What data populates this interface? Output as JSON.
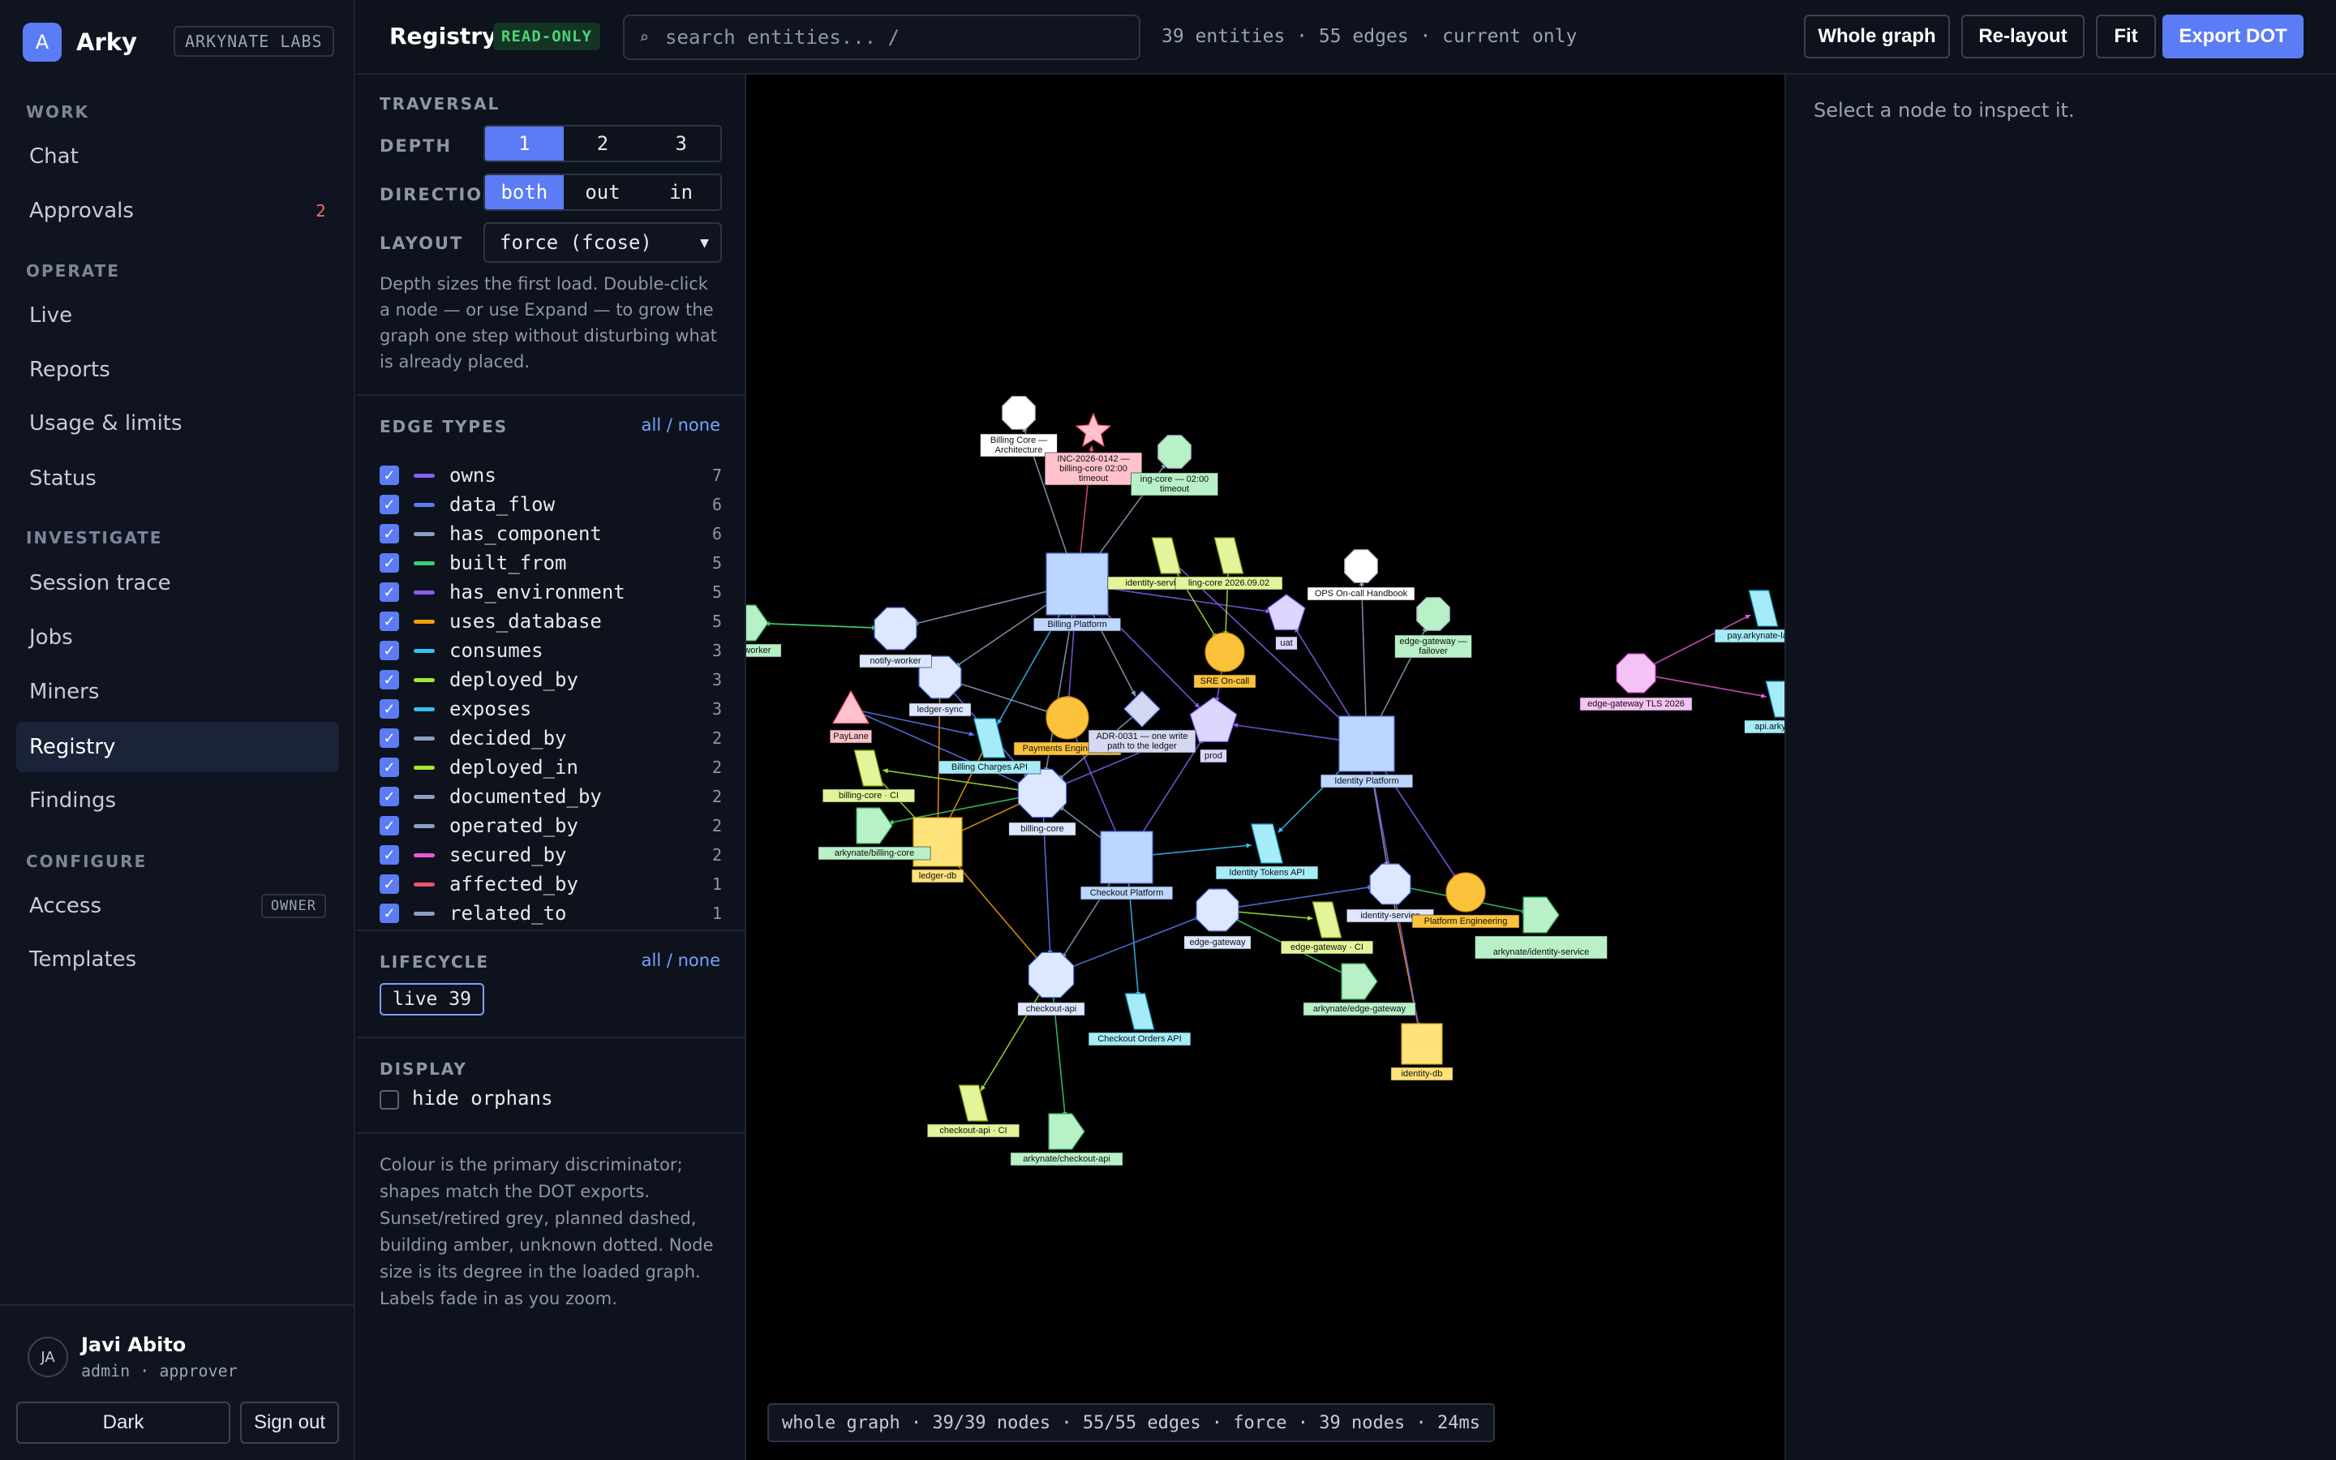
{
  "brand": {
    "logo_letter": "A",
    "name": "Arky",
    "org": "ARKYNATE LABS"
  },
  "nav": {
    "sections": [
      {
        "title": "WORK",
        "items": [
          {
            "label": "Chat"
          },
          {
            "label": "Approvals",
            "count": "2"
          }
        ]
      },
      {
        "title": "OPERATE",
        "items": [
          {
            "label": "Live"
          },
          {
            "label": "Reports"
          },
          {
            "label": "Usage & limits"
          },
          {
            "label": "Status"
          }
        ]
      },
      {
        "title": "INVESTIGATE",
        "items": [
          {
            "label": "Session trace"
          },
          {
            "label": "Jobs"
          },
          {
            "label": "Miners"
          },
          {
            "label": "Registry",
            "active": true
          },
          {
            "label": "Findings"
          }
        ]
      },
      {
        "title": "CONFIGURE",
        "items": [
          {
            "label": "Access",
            "tag": "OWNER"
          },
          {
            "label": "Templates"
          }
        ]
      }
    ]
  },
  "user": {
    "initials": "JA",
    "name": "Javi Abito",
    "role": "admin · approver",
    "theme_button": "Dark",
    "signout_button": "Sign out"
  },
  "header": {
    "title": "Registry",
    "badge": "READ-ONLY",
    "search_placeholder": "search entities...  /",
    "stats": "39 entities · 55 edges · current only",
    "buttons": {
      "whole_graph": "Whole graph",
      "relayout": "Re-layout",
      "fit": "Fit",
      "export": "Export DOT"
    }
  },
  "traversal": {
    "title": "TRAVERSAL",
    "depth_label": "DEPTH",
    "depth_options": [
      "1",
      "2",
      "3"
    ],
    "depth_selected": "1",
    "direction_label": "DIRECTION",
    "direction_options": [
      "both",
      "out",
      "in"
    ],
    "direction_selected": "both",
    "layout_label": "LAYOUT",
    "layout_value": "force (fcose)",
    "help": "Depth sizes the first load. Double-click a node — or use Expand — to grow the graph one step without disturbing what is already placed."
  },
  "edge_types": {
    "title": "EDGE TYPES",
    "toggle": "all / none",
    "items": [
      {
        "name": "owns",
        "count": "7",
        "color": "#8b5cf6"
      },
      {
        "name": "data_flow",
        "count": "6",
        "color": "#5b7cf5"
      },
      {
        "name": "has_component",
        "count": "6",
        "color": "#8aa0c0"
      },
      {
        "name": "built_from",
        "count": "5",
        "color": "#3fcf6e"
      },
      {
        "name": "has_environment",
        "count": "5",
        "color": "#8b5cf6"
      },
      {
        "name": "uses_database",
        "count": "5",
        "color": "#f59e0b"
      },
      {
        "name": "consumes",
        "count": "3",
        "color": "#38bdf8"
      },
      {
        "name": "deployed_by",
        "count": "3",
        "color": "#a3e635"
      },
      {
        "name": "exposes",
        "count": "3",
        "color": "#38bdf8"
      },
      {
        "name": "decided_by",
        "count": "2",
        "color": "#8aa0c0"
      },
      {
        "name": "deployed_in",
        "count": "2",
        "color": "#a3e635"
      },
      {
        "name": "documented_by",
        "count": "2",
        "color": "#8aa0c0"
      },
      {
        "name": "operated_by",
        "count": "2",
        "color": "#8aa0c0"
      },
      {
        "name": "secured_by",
        "count": "2",
        "color": "#e85ad8"
      },
      {
        "name": "affected_by",
        "count": "1",
        "color": "#f0506e"
      },
      {
        "name": "related_to",
        "count": "1",
        "color": "#8aa0c0"
      }
    ]
  },
  "lifecycle": {
    "title": "LIFECYCLE",
    "toggle": "all / none",
    "chip": "live 39"
  },
  "display": {
    "title": "DISPLAY",
    "hide_orphans": "hide orphans"
  },
  "legend_note": "Colour is the primary discriminator; shapes match the DOT exports. Sunset/retired grey, planned dashed, building amber, unknown dotted. Node size is its degree in the loaded graph. Labels fade in as you zoom.",
  "status_bar": "whole graph · 39/39 nodes · 55/55 edges · force · 39 nodes · 24ms",
  "inspector": {
    "hint": "Select a node to inspect it."
  },
  "graph": {
    "nodes": [
      {
        "id": "billing-platform",
        "label": "Billing Platform",
        "kind": "system",
        "color": "#bcd6ff"
      },
      {
        "id": "identity-platform",
        "label": "Identity Platform",
        "kind": "system",
        "color": "#bcd6ff"
      },
      {
        "id": "checkout-platform",
        "label": "Checkout Platform",
        "kind": "system",
        "color": "#bcd6ff"
      },
      {
        "id": "billing-core",
        "label": "billing-core",
        "kind": "service",
        "color": "#dde7ff"
      },
      {
        "id": "ledger-sync",
        "label": "ledger-sync",
        "kind": "service",
        "color": "#dde7ff"
      },
      {
        "id": "notify-worker",
        "label": "notify-worker",
        "kind": "service",
        "color": "#dde7ff"
      },
      {
        "id": "checkout-api",
        "label": "checkout-api",
        "kind": "service",
        "color": "#dde7ff"
      },
      {
        "id": "edge-gateway",
        "label": "edge-gateway",
        "kind": "service",
        "color": "#dde7ff"
      },
      {
        "id": "identity-service",
        "label": "identity-service",
        "kind": "service",
        "color": "#dde7ff"
      },
      {
        "id": "ledger-db",
        "label": "ledger-db",
        "kind": "database",
        "color": "#ffe27a"
      },
      {
        "id": "identity-db",
        "label": "identity-db",
        "kind": "database",
        "color": "#ffe27a"
      },
      {
        "id": "payments-eng",
        "label": "Payments Engineering",
        "kind": "team",
        "color": "#fcc23b"
      },
      {
        "id": "sre-oncall",
        "label": "SRE On-call",
        "kind": "team",
        "color": "#fcc23b"
      },
      {
        "id": "platform-eng",
        "label": "Platform Engineering",
        "kind": "team",
        "color": "#fcc23b"
      },
      {
        "id": "billing-charges-api",
        "label": "Billing Charges API",
        "kind": "api",
        "color": "#a6ecf8"
      },
      {
        "id": "identity-tokens-api",
        "label": "Identity Tokens API",
        "kind": "api",
        "color": "#a6ecf8"
      },
      {
        "id": "checkout-orders-api",
        "label": "Checkout Orders API",
        "kind": "api",
        "color": "#a6ecf8"
      },
      {
        "id": "pay-host",
        "label": "pay.arkynate-labs.",
        "kind": "api",
        "color": "#a6ecf8"
      },
      {
        "id": "api-host",
        "label": "api.arkynate-",
        "kind": "api",
        "color": "#a6ecf8"
      },
      {
        "id": "billing-core-ci",
        "label": "billing-core · CI",
        "kind": "pipeline",
        "color": "#e2f59a"
      },
      {
        "id": "edge-gateway-ci",
        "label": "edge-gateway · CI",
        "kind": "pipeline",
        "color": "#e2f59a"
      },
      {
        "id": "checkout-api-ci",
        "label": "checkout-api · CI",
        "kind": "pipeline",
        "color": "#e2f59a"
      },
      {
        "id": "repo-billing-core",
        "label": "arkynate/billing-core",
        "kind": "repo",
        "color": "#b8f0c8"
      },
      {
        "id": "repo-identity-service",
        "label": "arkynate/identity-service",
        "kind": "repo",
        "color": "#b8f0c8"
      },
      {
        "id": "repo-edge-gateway",
        "label": "arkynate/edge-gateway",
        "kind": "repo",
        "color": "#b8f0c8"
      },
      {
        "id": "repo-checkout-api",
        "label": "arkynate/checkout-api",
        "kind": "repo",
        "color": "#b8f0c8"
      },
      {
        "id": "repo-notify-worker",
        "label": "tify-worker",
        "kind": "repo",
        "color": "#b8f0c8"
      },
      {
        "id": "release-identity",
        "label": "identity-service 3.4.0",
        "kind": "release",
        "color": "#e2f59a"
      },
      {
        "id": "release-billing",
        "label": "ling-core 2026.09.02",
        "kind": "release",
        "color": "#e2f59a"
      },
      {
        "id": "env-uat",
        "label": "uat",
        "kind": "environment",
        "color": "#ddd6fe"
      },
      {
        "id": "env-prod",
        "label": "prod",
        "kind": "environment",
        "color": "#ddd6fe"
      },
      {
        "id": "adr-0031",
        "label": "ADR-0031 — one write path to the ledger",
        "kind": "decision",
        "color": "#d4d8f0"
      },
      {
        "id": "doc-billing-arch",
        "label": "Billing Core — Architecture",
        "kind": "document",
        "color": "#ffffff"
      },
      {
        "id": "doc-ops-oncall",
        "label": "OPS On-call Handbook",
        "kind": "document",
        "color": "#ffffff"
      },
      {
        "id": "incident",
        "label": "INC-2026-0142 — billing-core 02:00 timeout",
        "kind": "incident",
        "color": "#ffc2cc"
      },
      {
        "id": "runbook-billing",
        "label": "ing-core — 02:00 timeout",
        "kind": "runbook",
        "color": "#b8f0c8"
      },
      {
        "id": "runbook-edge",
        "label": "edge-gateway — failover",
        "kind": "runbook",
        "color": "#b8f0c8"
      },
      {
        "id": "tls-cert",
        "label": "edge-gateway TLS 2026",
        "kind": "certificate",
        "color": "#f5c2f5"
      },
      {
        "id": "paylane",
        "label": "PayLane",
        "kind": "vendor",
        "color": "#ffc2cc"
      }
    ]
  }
}
